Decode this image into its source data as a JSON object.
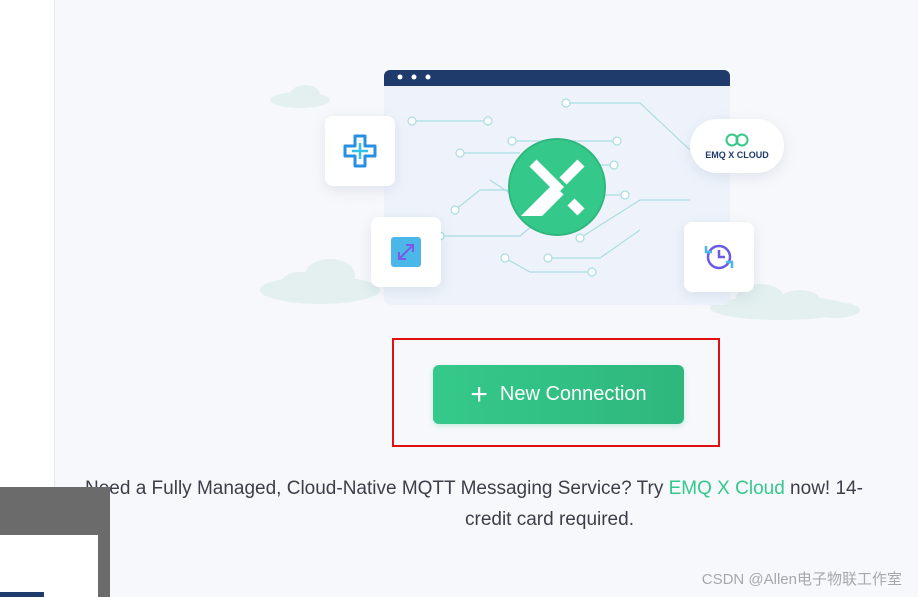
{
  "illustration": {
    "cloud_badge_text": "EMQ X CLOUD"
  },
  "new_connection_button": {
    "label": "New Connection"
  },
  "promo": {
    "text_before": "Need a Fully Managed, Cloud-Native MQTT Messaging Service? Try ",
    "link_text": "EMQ X Cloud",
    "text_after": " now! 14-",
    "line2": "credit card required."
  },
  "watermark": "CSDN @Allen电子物联工作室",
  "colors": {
    "accent": "#34c98a",
    "highlight": "#e01010",
    "browser_bar": "#1e3b6b"
  }
}
